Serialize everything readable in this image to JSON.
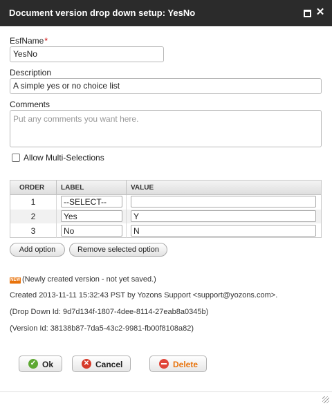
{
  "window": {
    "title": "Document version drop down setup: YesNo"
  },
  "form": {
    "esfname_label": "EsfName",
    "required_mark": "*",
    "esfname_value": "YesNo",
    "description_label": "Description",
    "description_value": "A simple yes or no choice list",
    "comments_label": "Comments",
    "comments_placeholder": "Put any comments you want here.",
    "allow_multi_label": "Allow Multi-Selections"
  },
  "options_table": {
    "columns": [
      "ORDER",
      "LABEL",
      "VALUE"
    ],
    "rows": [
      {
        "order": "1",
        "label": "--SELECT--",
        "value": ""
      },
      {
        "order": "2",
        "label": "Yes",
        "value": "Y"
      },
      {
        "order": "3",
        "label": "No",
        "value": "N"
      }
    ]
  },
  "buttons": {
    "add_option": "Add option",
    "remove_option": "Remove selected option",
    "ok": "Ok",
    "cancel": "Cancel",
    "delete": "Delete"
  },
  "info": {
    "new_badge": "NEW",
    "status": "(Newly created version - not yet saved.)",
    "created": "Created 2013-11-11 15:32:43 PST by Yozons Support <support@yozons.com>.",
    "dropdown_id": "(Drop Down Id: 9d7d134f-1807-4dee-8114-27eab8a0345b)",
    "version_id": "(Version Id: 38138b87-7da5-43c2-9981-fb00f8108a82)"
  },
  "colors": {
    "titlebar": "#2b2b2b",
    "ok_icon": "#5da832",
    "cancel_icon": "#d63a2a",
    "delete_text": "#e8730c",
    "new_badge": "#e8730c"
  }
}
